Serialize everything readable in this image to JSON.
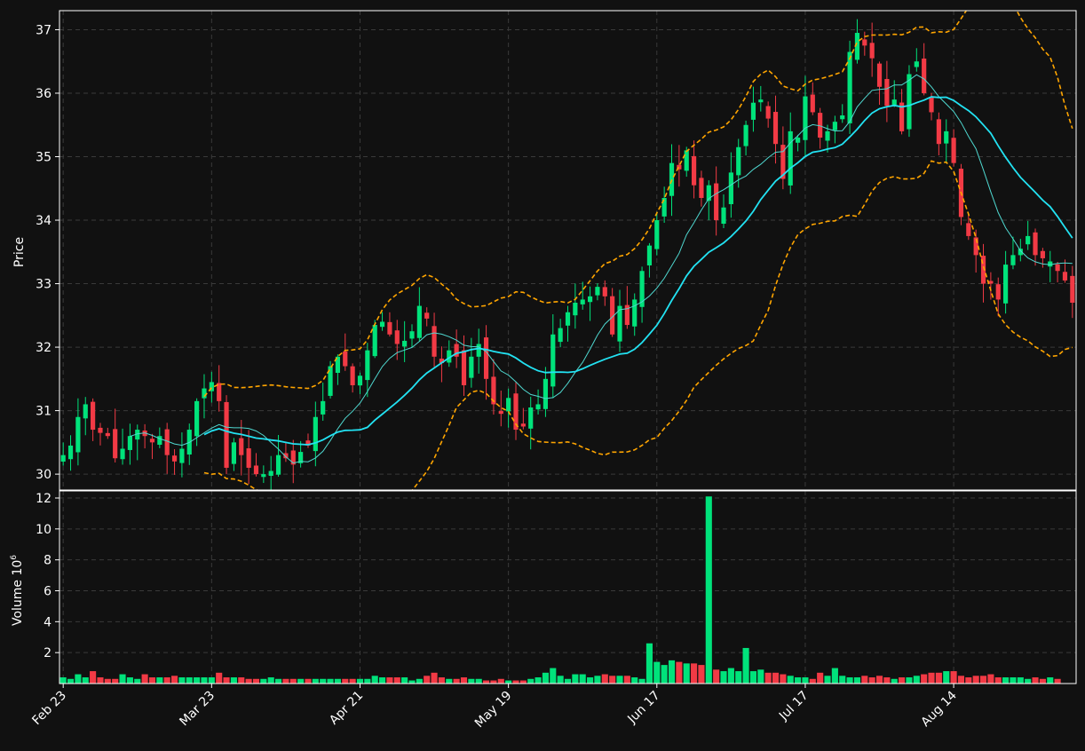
{
  "chart_data": {
    "type": "candlestick",
    "price_panel": {
      "ylabel": "Price",
      "yticks": [
        30,
        31,
        32,
        33,
        34,
        35,
        36,
        37
      ],
      "ylim": [
        29.75,
        37.3
      ],
      "grid": true,
      "close": [
        30.3,
        30.45,
        30.9,
        31.1,
        30.7,
        30.65,
        30.6,
        30.25,
        30.4,
        30.6,
        30.7,
        30.6,
        30.5,
        30.6,
        30.3,
        30.2,
        30.4,
        30.7,
        31.15,
        31.35,
        31.45,
        31.15,
        30.1,
        30.5,
        30.3,
        30.1,
        30.0,
        30.0,
        30.05,
        30.3,
        30.25,
        30.15,
        30.35,
        30.45,
        30.9,
        31.15,
        31.7,
        31.85,
        31.7,
        31.4,
        31.55,
        31.95,
        32.35,
        32.4,
        32.2,
        32.05,
        32.1,
        32.25,
        32.65,
        32.45,
        31.85,
        31.75,
        31.95,
        31.85,
        31.4,
        31.85,
        32.05,
        31.5,
        31.1,
        30.95,
        31.2,
        30.7,
        30.75,
        31.05,
        31.1,
        31.5,
        32.2,
        32.3,
        32.55,
        32.7,
        32.75,
        32.8,
        32.95,
        32.8,
        32.2,
        32.65,
        32.35,
        32.75,
        33.2,
        33.6,
        34.0,
        34.35,
        34.9,
        34.8,
        35.1,
        34.55,
        34.35,
        34.55,
        34.0,
        34.2,
        34.75,
        35.15,
        35.5,
        35.85,
        35.9,
        35.6,
        35.2,
        34.65,
        35.4,
        35.3,
        35.95,
        35.7,
        35.3,
        35.4,
        35.55,
        35.65,
        36.65,
        36.95,
        36.75,
        36.55,
        36.1,
        35.8,
        35.9,
        35.4,
        36.3,
        36.5,
        36.0,
        35.7,
        35.2,
        35.4,
        34.9,
        34.05,
        33.75,
        33.45,
        33.0,
        33.0,
        32.75,
        33.3,
        33.45,
        33.55,
        33.75,
        33.45,
        33.4,
        33.35,
        33.2,
        33.05,
        32.7
      ],
      "sma_fast_color": "#4fd8d0",
      "sma_slow_color": "#22e2f2",
      "band_color": "#ffa500",
      "up_color": "#00e37b",
      "down_color": "#f23a45"
    },
    "volume_panel": {
      "ylabel": "Volume  10",
      "ylabel_exponent": "6",
      "yticks": [
        2,
        4,
        6,
        8,
        10,
        12
      ],
      "ylim": [
        0,
        12
      ],
      "grid": true,
      "values": [
        0.4,
        0.3,
        0.6,
        0.4,
        0.8,
        0.4,
        0.3,
        0.3,
        0.6,
        0.4,
        0.3,
        0.6,
        0.4,
        0.4,
        0.4,
        0.5,
        0.4,
        0.4,
        0.4,
        0.4,
        0.4,
        0.7,
        0.4,
        0.4,
        0.4,
        0.3,
        0.3,
        0.3,
        0.4,
        0.3,
        0.3,
        0.3,
        0.3,
        0.3,
        0.3,
        0.3,
        0.3,
        0.3,
        0.3,
        0.3,
        0.3,
        0.3,
        0.5,
        0.4,
        0.4,
        0.4,
        0.4,
        0.2,
        0.3,
        0.5,
        0.7,
        0.4,
        0.3,
        0.3,
        0.4,
        0.3,
        0.3,
        0.2,
        0.2,
        0.3,
        0.2,
        0.2,
        0.2,
        0.3,
        0.4,
        0.7,
        1.0,
        0.5,
        0.3,
        0.6,
        0.6,
        0.4,
        0.5,
        0.6,
        0.5,
        0.5,
        0.5,
        0.4,
        0.3,
        2.6,
        1.4,
        1.2,
        1.5,
        1.4,
        1.3,
        1.3,
        1.2,
        12.1,
        0.9,
        0.8,
        1.0,
        0.8,
        2.3,
        0.8,
        0.9,
        0.7,
        0.7,
        0.6,
        0.5,
        0.4,
        0.4,
        0.3,
        0.7,
        0.5,
        1.0,
        0.5,
        0.4,
        0.4,
        0.5,
        0.4,
        0.5,
        0.4,
        0.3,
        0.4,
        0.4,
        0.5,
        0.6,
        0.7,
        0.7,
        0.8,
        0.8,
        0.5,
        0.4,
        0.5,
        0.5,
        0.6,
        0.4,
        0.4,
        0.4,
        0.4,
        0.3,
        0.4,
        0.3,
        0.4,
        0.3
      ]
    },
    "x_tick_labels": [
      {
        "label": "Feb 23",
        "index": 0
      },
      {
        "label": "Mar 23",
        "index": 20
      },
      {
        "label": "Apr 21",
        "index": 40
      },
      {
        "label": "May 19",
        "index": 60
      },
      {
        "label": "Jun 17",
        "index": 80
      },
      {
        "label": "Jul 17",
        "index": 100
      },
      {
        "label": "Aug 14",
        "index": 120
      }
    ]
  }
}
